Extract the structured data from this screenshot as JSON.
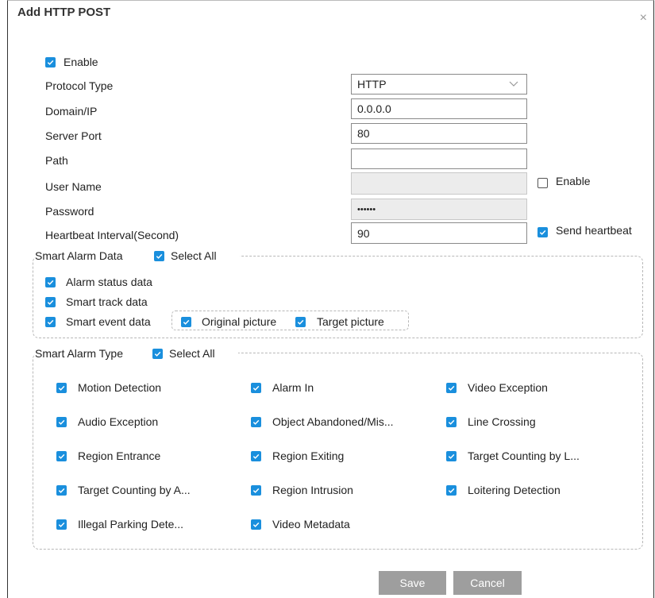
{
  "dialog": {
    "title": "Add HTTP POST",
    "close_glyph": "×",
    "enable_label": "Enable",
    "enable_checked": true
  },
  "form": {
    "protocol_type": {
      "label": "Protocol Type",
      "value": "HTTP"
    },
    "domain_ip": {
      "label": "Domain/IP",
      "value": "0.0.0.0"
    },
    "server_port": {
      "label": "Server Port",
      "value": "80"
    },
    "path": {
      "label": "Path",
      "value": ""
    },
    "user_name": {
      "label": "User Name",
      "value": "",
      "auth_enable_label": "Enable",
      "auth_enable_checked": false
    },
    "password": {
      "label": "Password",
      "value": "••••••"
    },
    "heartbeat": {
      "label": "Heartbeat Interval(Second)",
      "value": "90",
      "send_label": "Send heartbeat",
      "send_checked": true
    }
  },
  "smart_alarm_data": {
    "legend": "Smart Alarm Data",
    "select_all": "Select All",
    "items": {
      "alarm_status": "Alarm status data",
      "smart_track": "Smart track data",
      "smart_event": "Smart event data",
      "original_picture": "Original picture",
      "target_picture": "Target picture"
    }
  },
  "smart_alarm_type": {
    "legend": "Smart Alarm Type",
    "select_all": "Select All",
    "items": [
      "Motion Detection",
      "Alarm In",
      "Video Exception",
      "Audio Exception",
      "Object Abandoned/Mis...",
      "Line Crossing",
      "Region Entrance",
      "Region Exiting",
      "Target Counting by L...",
      "Target Counting by A...",
      "Region Intrusion",
      "Loitering Detection",
      "Illegal Parking Dete...",
      "Video Metadata"
    ]
  },
  "buttons": {
    "save": "Save",
    "cancel": "Cancel"
  },
  "colors": {
    "checkbox": "#1a8fdd",
    "button": "#9e9e9e"
  },
  "icons": {
    "check": "check-icon",
    "close": "close-icon",
    "dropdown": "chevron-down-icon"
  }
}
